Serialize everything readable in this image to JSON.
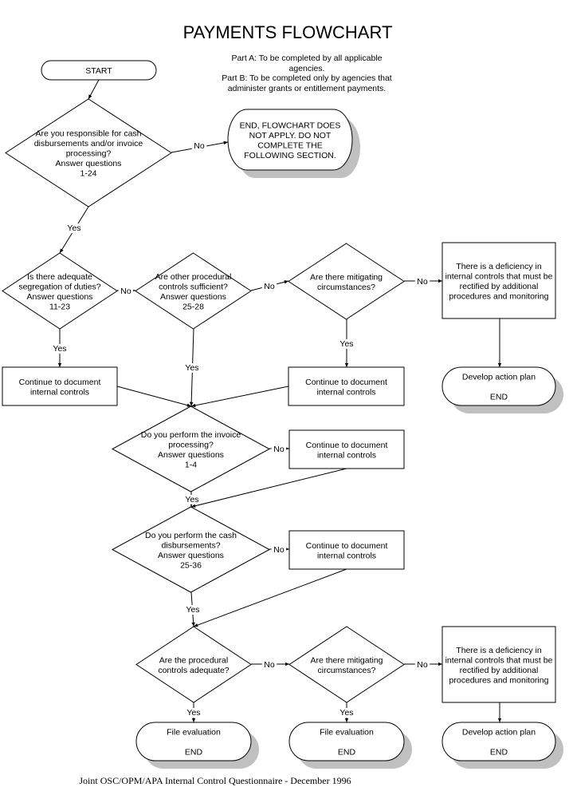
{
  "title": "PAYMENTS FLOWCHART",
  "notes": [
    "Part A: To be completed by all applicable",
    "agencies.",
    "Part B: To be completed only by agencies that",
    "administer grants or entitlement payments."
  ],
  "footer": "Joint OSC/OPM/APA Internal Control Questionnaire - December 1996",
  "colors": {
    "line": "#000000",
    "fill": "#ffffff",
    "shadow": "#c0c0c0"
  },
  "nodes": {
    "start": {
      "type": "terminal",
      "lines": [
        "START"
      ]
    },
    "q_responsible": {
      "type": "decision",
      "lines": [
        "Are you responsible for cash",
        "disbursements and/or invoice",
        "processing?",
        "Answer questions",
        "1-24"
      ]
    },
    "end_not_apply": {
      "type": "terminal",
      "lines": [
        "END, FLOWCHART DOES",
        "NOT APPLY. DO NOT",
        "COMPLETE THE",
        "FOLLOWING SECTION."
      ]
    },
    "q_segregation": {
      "type": "decision",
      "lines": [
        "Is there adequate",
        "segregation of duties?",
        "Answer questions",
        "11-23"
      ]
    },
    "q_other_controls": {
      "type": "decision",
      "lines": [
        "Are other procedural",
        "controls sufficient?",
        "Answer questions",
        "25-28"
      ]
    },
    "q_mitigating_1": {
      "type": "decision",
      "lines": [
        "Are there mitigating",
        "circumstances?"
      ]
    },
    "deficiency_1": {
      "type": "process",
      "lines": [
        "There is a deficiency in",
        "internal controls that must be",
        "rectified by additional",
        "procedures and monitoring"
      ]
    },
    "continue_1": {
      "type": "process",
      "lines": [
        "Continue to document",
        "internal controls"
      ]
    },
    "continue_2": {
      "type": "process",
      "lines": [
        "Continue to document",
        "internal controls"
      ]
    },
    "action_plan_1": {
      "type": "terminal",
      "lines": [
        "Develop action plan",
        "",
        "END"
      ]
    },
    "q_invoice": {
      "type": "decision",
      "lines": [
        "Do you perform the invoice",
        "processing?",
        "Answer questions",
        "1-4"
      ]
    },
    "continue_3": {
      "type": "process",
      "lines": [
        "Continue to document",
        "internal controls"
      ]
    },
    "q_cash": {
      "type": "decision",
      "lines": [
        "Do you perform the cash",
        "disbursements?",
        "Answer questions",
        "25-36"
      ]
    },
    "continue_4": {
      "type": "process",
      "lines": [
        "Continue to document",
        "internal controls"
      ]
    },
    "q_procedural_adequate": {
      "type": "decision",
      "lines": [
        "Are the procedural",
        "controls adequate?"
      ]
    },
    "q_mitigating_2": {
      "type": "decision",
      "lines": [
        "Are there mitigating",
        "circumstances?"
      ]
    },
    "deficiency_2": {
      "type": "process",
      "lines": [
        "There is a deficiency in",
        "internal controls that must be",
        "rectified by additional",
        "procedures and monitoring"
      ]
    },
    "file_eval_1": {
      "type": "terminal",
      "lines": [
        "File evaluation",
        "",
        "END"
      ]
    },
    "file_eval_2": {
      "type": "terminal",
      "lines": [
        "File evaluation",
        "",
        "END"
      ]
    },
    "action_plan_2": {
      "type": "terminal",
      "lines": [
        "Develop action plan",
        "",
        "END"
      ]
    }
  },
  "edges": [
    {
      "from": "start",
      "to": "q_responsible",
      "label": ""
    },
    {
      "from": "q_responsible",
      "to": "end_not_apply",
      "label": "No"
    },
    {
      "from": "q_responsible",
      "to": "q_segregation",
      "label": "Yes"
    },
    {
      "from": "q_segregation",
      "to": "q_other_controls",
      "label": "No"
    },
    {
      "from": "q_segregation",
      "to": "continue_1",
      "label": "Yes"
    },
    {
      "from": "q_other_controls",
      "to": "q_mitigating_1",
      "label": "No"
    },
    {
      "from": "q_other_controls",
      "to": "q_invoice",
      "label": "Yes"
    },
    {
      "from": "q_mitigating_1",
      "to": "deficiency_1",
      "label": "No"
    },
    {
      "from": "q_mitigating_1",
      "to": "continue_2",
      "label": "Yes"
    },
    {
      "from": "deficiency_1",
      "to": "action_plan_1",
      "label": ""
    },
    {
      "from": "continue_1",
      "to": "q_invoice",
      "label": ""
    },
    {
      "from": "continue_2",
      "to": "q_invoice",
      "label": ""
    },
    {
      "from": "q_invoice",
      "to": "continue_3",
      "label": "No"
    },
    {
      "from": "q_invoice",
      "to": "q_cash",
      "label": "Yes"
    },
    {
      "from": "continue_3",
      "to": "q_cash",
      "label": ""
    },
    {
      "from": "q_cash",
      "to": "continue_4",
      "label": "No"
    },
    {
      "from": "q_cash",
      "to": "q_procedural_adequate",
      "label": "Yes"
    },
    {
      "from": "continue_4",
      "to": "q_procedural_adequate",
      "label": ""
    },
    {
      "from": "q_procedural_adequate",
      "to": "q_mitigating_2",
      "label": "No"
    },
    {
      "from": "q_procedural_adequate",
      "to": "file_eval_1",
      "label": "Yes"
    },
    {
      "from": "q_mitigating_2",
      "to": "deficiency_2",
      "label": "No"
    },
    {
      "from": "q_mitigating_2",
      "to": "file_eval_2",
      "label": "Yes"
    },
    {
      "from": "deficiency_2",
      "to": "action_plan_2",
      "label": ""
    }
  ]
}
